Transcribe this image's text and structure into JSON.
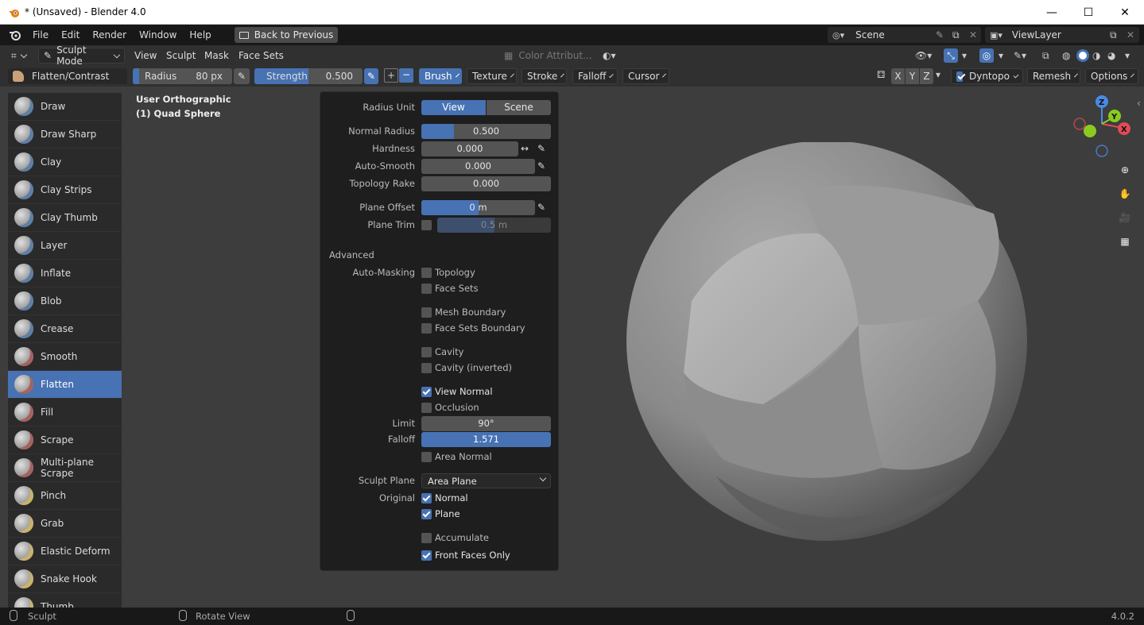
{
  "window": {
    "title": "* (Unsaved) - Blender 4.0",
    "minimize": "—",
    "maximize": "☐",
    "close": "✕"
  },
  "menu": {
    "items": [
      "File",
      "Edit",
      "Render",
      "Window",
      "Help"
    ],
    "back_button": "Back to Previous",
    "scene": "Scene",
    "view_layer": "ViewLayer"
  },
  "header": {
    "mode": "Sculpt Mode",
    "menus": [
      "View",
      "Sculpt",
      "Mask",
      "Face Sets"
    ],
    "color_attribute": "Color Attribut..."
  },
  "toolbar": {
    "brush_name": "Flatten/Contrast",
    "radius_label": "Radius",
    "radius_value": "80 px",
    "strength_label": "Strength",
    "strength_value": "0.500",
    "strength_fraction": 0.5,
    "plus": "+",
    "minus": "−",
    "dropdowns": [
      "Brush",
      "Texture",
      "Stroke",
      "Falloff",
      "Cursor"
    ],
    "axes": [
      "X",
      "Y",
      "Z"
    ],
    "dyntopo": "Dyntopo",
    "remesh": "Remesh",
    "options": "Options"
  },
  "viewport": {
    "view_name": "User Orthographic",
    "object_name": "(1) Quad Sphere"
  },
  "tools": [
    "Draw",
    "Draw Sharp",
    "Clay",
    "Clay Strips",
    "Clay Thumb",
    "Layer",
    "Inflate",
    "Blob",
    "Crease",
    "Smooth",
    "Flatten",
    "Fill",
    "Scrape",
    "Multi-plane Scrape",
    "Pinch",
    "Grab",
    "Elastic Deform",
    "Snake Hook",
    "Thumb"
  ],
  "selected_tool": "Flatten",
  "popup": {
    "radius_unit_label": "Radius Unit",
    "radius_unit_view": "View",
    "radius_unit_scene": "Scene",
    "normal_radius_label": "Normal Radius",
    "normal_radius": "0.500",
    "normal_radius_fraction": 0.25,
    "hardness_label": "Hardness",
    "hardness": "0.000",
    "autosmooth_label": "Auto-Smooth",
    "autosmooth": "0.000",
    "topology_rake_label": "Topology Rake",
    "topology_rake": "0.000",
    "plane_offset_label": "Plane Offset",
    "plane_offset": "0 m",
    "plane_offset_fraction": 0.5,
    "plane_trim_label": "Plane Trim",
    "plane_trim": "0.5 m",
    "plane_trim_fraction": 0.5,
    "advanced_label": "Advanced",
    "auto_masking_label": "Auto-Masking",
    "topology": "Topology",
    "face_sets": "Face Sets",
    "mesh_boundary": "Mesh Boundary",
    "face_sets_boundary": "Face Sets Boundary",
    "cavity": "Cavity",
    "cavity_inverted": "Cavity (inverted)",
    "view_normal": "View Normal",
    "occlusion": "Occlusion",
    "limit_label": "Limit",
    "limit": "90°",
    "falloff_label": "Falloff",
    "falloff": "1.571",
    "area_normal": "Area Normal",
    "sculpt_plane_label": "Sculpt Plane",
    "sculpt_plane": "Area Plane",
    "original_label": "Original",
    "original_normal": "Normal",
    "original_plane": "Plane",
    "accumulate": "Accumulate",
    "front_faces_only": "Front Faces Only"
  },
  "status": {
    "mode": "Sculpt",
    "action": "Rotate View",
    "version": "4.0.2"
  },
  "colors": {
    "accent": "#4772b3",
    "bg": "#3d3d3d",
    "panel": "#1e1e1e",
    "field": "#545454"
  }
}
